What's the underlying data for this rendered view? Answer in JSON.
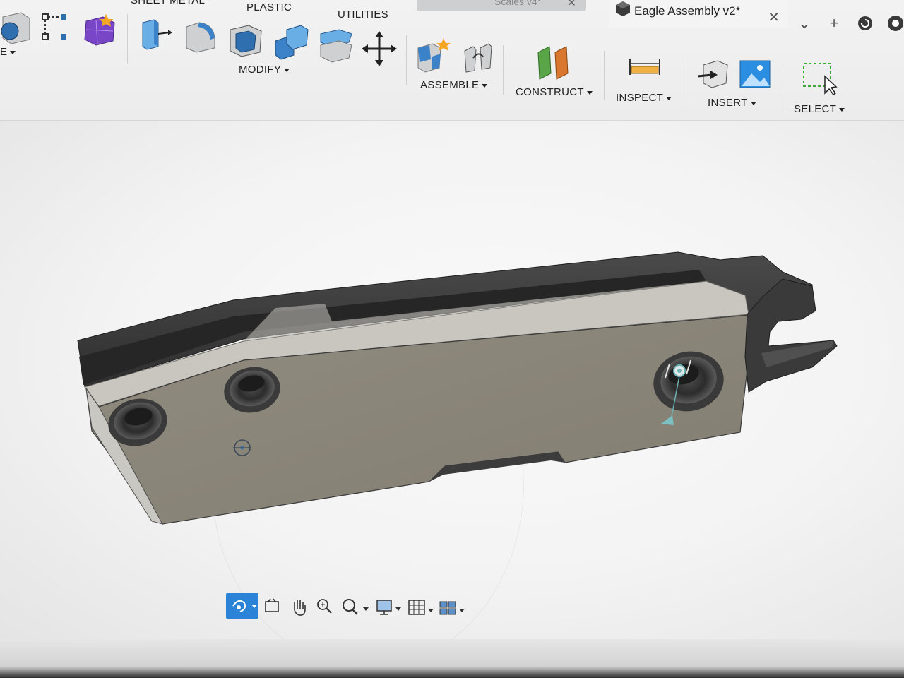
{
  "tabs": {
    "inactive": {
      "label": "Scales v4*"
    },
    "active": {
      "label": "Eagle Assembly v2*"
    }
  },
  "tab_controls": [
    "chevron-down",
    "plus",
    "history",
    "account"
  ],
  "ribbon": {
    "tabs": [
      {
        "label": "SHEET METAL"
      },
      {
        "label": "PLASTIC"
      },
      {
        "label": "UTILITIES"
      }
    ],
    "groups": {
      "create": {
        "label": "E"
      },
      "modify": {
        "label": "MODIFY"
      },
      "assemble": {
        "label": "ASSEMBLE"
      },
      "construct": {
        "label": "CONSTRUCT"
      },
      "inspect": {
        "label": "INSPECT"
      },
      "insert": {
        "label": "INSERT"
      },
      "select": {
        "label": "SELECT"
      }
    }
  },
  "navbar": {
    "items": [
      "orbit",
      "look-at",
      "pan",
      "zoom-window",
      "zoom",
      "display-settings",
      "grid-settings",
      "viewports"
    ]
  },
  "colors": {
    "accent": "#2b83d8",
    "body_face": "#8b877a",
    "body_dark": "#3a3a3a",
    "construct_green": "#5aa548",
    "construct_orange": "#d8772d"
  }
}
